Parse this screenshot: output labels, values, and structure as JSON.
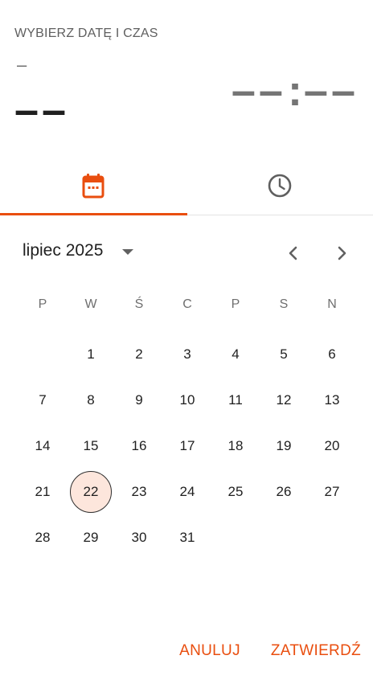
{
  "header": {
    "title": "WYBIERZ DATĘ I CZAS",
    "date_small_placeholder": "–",
    "date_large_placeholder": "––",
    "time_hours_placeholder": "––",
    "time_separator": ":",
    "time_minutes_placeholder": "––"
  },
  "tabs": [
    {
      "name": "date",
      "icon": "calendar-icon",
      "selected": true
    },
    {
      "name": "time",
      "icon": "clock-icon",
      "selected": false
    }
  ],
  "colors": {
    "accent": "#e94e0f",
    "today_fill": "#fde6dc"
  },
  "calendar": {
    "month_label": "lipiec 2025",
    "weekdays": [
      "P",
      "W",
      "Ś",
      "C",
      "P",
      "S",
      "N"
    ],
    "weeks": [
      [
        "",
        "1",
        "2",
        "3",
        "4",
        "5",
        "6"
      ],
      [
        "7",
        "8",
        "9",
        "10",
        "11",
        "12",
        "13"
      ],
      [
        "14",
        "15",
        "16",
        "17",
        "18",
        "19",
        "20"
      ],
      [
        "21",
        "22",
        "23",
        "24",
        "25",
        "26",
        "27"
      ],
      [
        "28",
        "29",
        "30",
        "31",
        "",
        "",
        ""
      ]
    ],
    "highlighted_day": "22"
  },
  "actions": {
    "cancel_label": "ANULUJ",
    "confirm_label": "ZATWIERDŹ"
  }
}
